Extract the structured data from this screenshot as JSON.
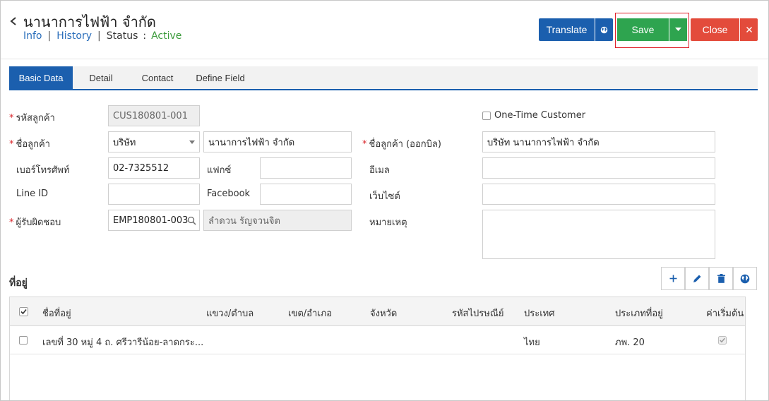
{
  "header": {
    "title": "นานาการไฟฟ้า จำกัด",
    "links": {
      "info": "Info",
      "history": "History"
    },
    "separator": "|",
    "status_label": "Status",
    "status_colon": ":",
    "status_value": "Active"
  },
  "toolbar": {
    "translate_label": "Translate",
    "save_label": "Save",
    "close_label": "Close"
  },
  "tabs": [
    {
      "label": "Basic Data",
      "active": true
    },
    {
      "label": "Detail",
      "active": false
    },
    {
      "label": "Contact",
      "active": false
    },
    {
      "label": "Define Field",
      "active": false
    }
  ],
  "form": {
    "customer_code": {
      "label": "รหัสลูกค้า",
      "value": "CUS180801-001"
    },
    "one_time_customer": {
      "label": "One-Time Customer",
      "checked": false
    },
    "customer_name": {
      "label": "ชื่อลูกค้า",
      "type_value": "บริษัท",
      "value": "นานาการไฟฟ้า จำกัด"
    },
    "billing_name": {
      "label": "ชื่อลูกค้า (ออกบิล)",
      "value": "บริษัท นานาการไฟฟ้า จำกัด"
    },
    "phone": {
      "label": "เบอร์โทรศัพท์",
      "value": "02-7325512"
    },
    "fax": {
      "label": "แฟกซ์",
      "value": ""
    },
    "email": {
      "label": "อีเมล",
      "value": ""
    },
    "line_id": {
      "label": "Line ID",
      "value": ""
    },
    "facebook": {
      "label": "Facebook",
      "value": ""
    },
    "website": {
      "label": "เว็บไซต์",
      "value": ""
    },
    "responsible": {
      "label": "ผู้รับผิดชอบ",
      "code": "EMP180801-003",
      "name": "ลำดวน รัญจวนจิต"
    },
    "remark": {
      "label": "หมายเหตุ",
      "value": ""
    },
    "required_mark": "*"
  },
  "address": {
    "title": "ที่อยู่",
    "columns": [
      "ชื่อที่อยู่",
      "แขวง/ตำบล",
      "เขต/อำเภอ",
      "จังหวัด",
      "รหัสไปรษณีย์",
      "ประเทศ",
      "ประเภทที่อยู่",
      "ค่าเริ่มต้น"
    ],
    "rows": [
      {
        "name": "เลขที่ 30 หมู่ 4 ถ. ศรีวารีน้อย-ลาดกระ...",
        "subdistrict": "",
        "district": "",
        "province": "",
        "postcode": "",
        "country": "ไทย",
        "type": "ภพ. 20",
        "default": true
      }
    ]
  },
  "colors": {
    "primary": "#1b5fae",
    "success": "#2ea44f",
    "danger": "#e34b3b",
    "status_active": "#3a9a3a",
    "highlight": "#e0202a"
  }
}
